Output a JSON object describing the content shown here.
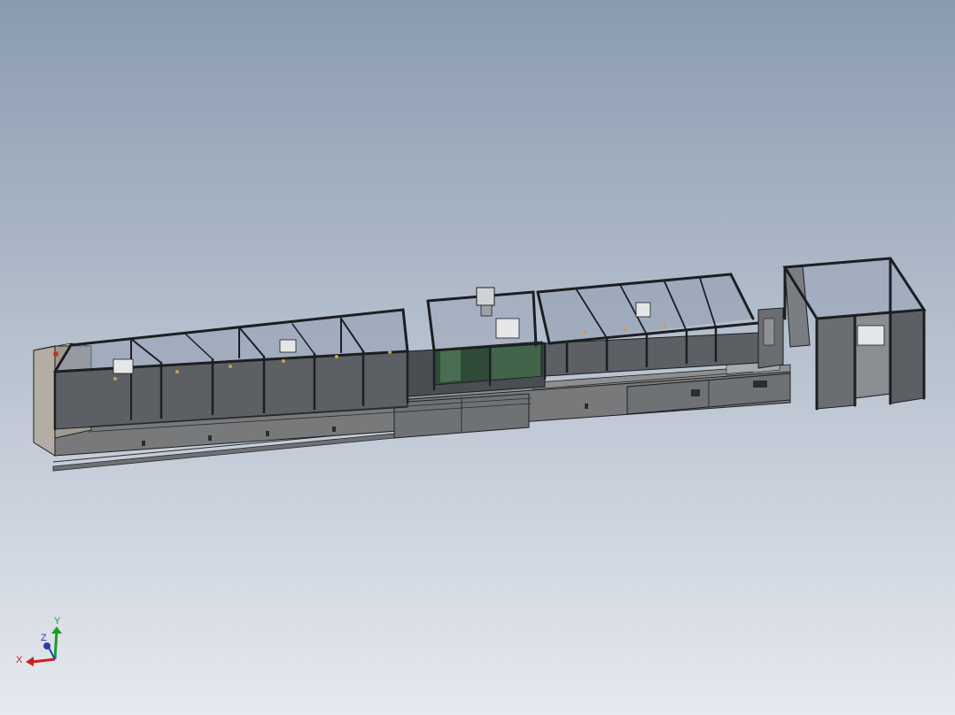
{
  "viewport": {
    "background_top": "#8a9bb0",
    "background_bottom": "#e6e9ef"
  },
  "model": {
    "frame_color": "#1c1f22",
    "panel_color": "#5c5f63",
    "panel_dark": "#3e4144",
    "glass_color": "#8f9ab0",
    "base_color": "#77797b",
    "green_panel": "#2f4a36"
  },
  "triad": {
    "x_label": "X",
    "y_label": "Y",
    "z_label": "Z",
    "x_color": "#cc1f1f",
    "y_color": "#1e9a2c",
    "z_color": "#2a3fa8"
  }
}
